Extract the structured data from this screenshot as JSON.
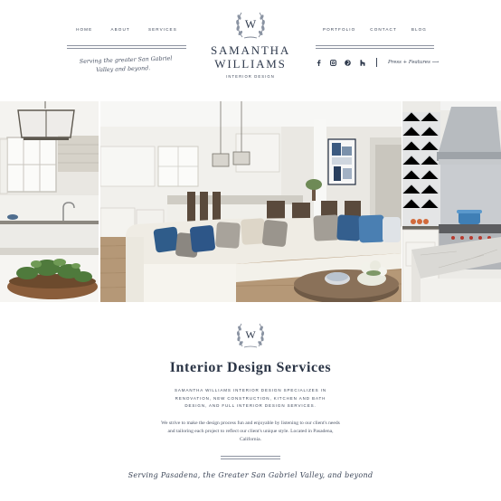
{
  "nav": {
    "left": [
      {
        "label": "HOME"
      },
      {
        "label": "ABOUT"
      },
      {
        "label": "SERVICES"
      }
    ],
    "right": [
      {
        "label": "PORTFOLIO"
      },
      {
        "label": "CONTACT"
      },
      {
        "label": "BLOG"
      }
    ]
  },
  "brand": {
    "monogram": "W",
    "name_line1": "SAMANTHA",
    "name_line2": "WILLIAMS",
    "subtitle": "INTERIOR DESIGN"
  },
  "tagline": {
    "line1": "Serving the greater San Gabriel",
    "line2": "Valley and beyond."
  },
  "social": {
    "icons": [
      "facebook-icon",
      "instagram-icon",
      "pinterest-icon",
      "houzz-icon"
    ],
    "press_link": "Press + Features ⟶"
  },
  "services": {
    "monogram": "W",
    "title": "Interior Design Services",
    "caps_text": "SAMANTHA WILLIAMS INTERIOR DESIGN SPECIALIZES IN RENOVATION, NEW CONSTRUCTION, KITCHEN AND BATH DESIGN, AND FULL INTERIOR DESIGN SERVICES.",
    "body_text": "We strive to make the design process fun and enjoyable by listening to our client's needs and tailoring each project to reflect our client's unique style. Located in Pasadena, California.",
    "bottom_tagline": "Serving Pasadena, the Greater San Gabriel Valley, and beyond"
  },
  "colors": {
    "navy": "#2f3a4d",
    "rule": "#8d93a0",
    "background": "#ffffff"
  }
}
